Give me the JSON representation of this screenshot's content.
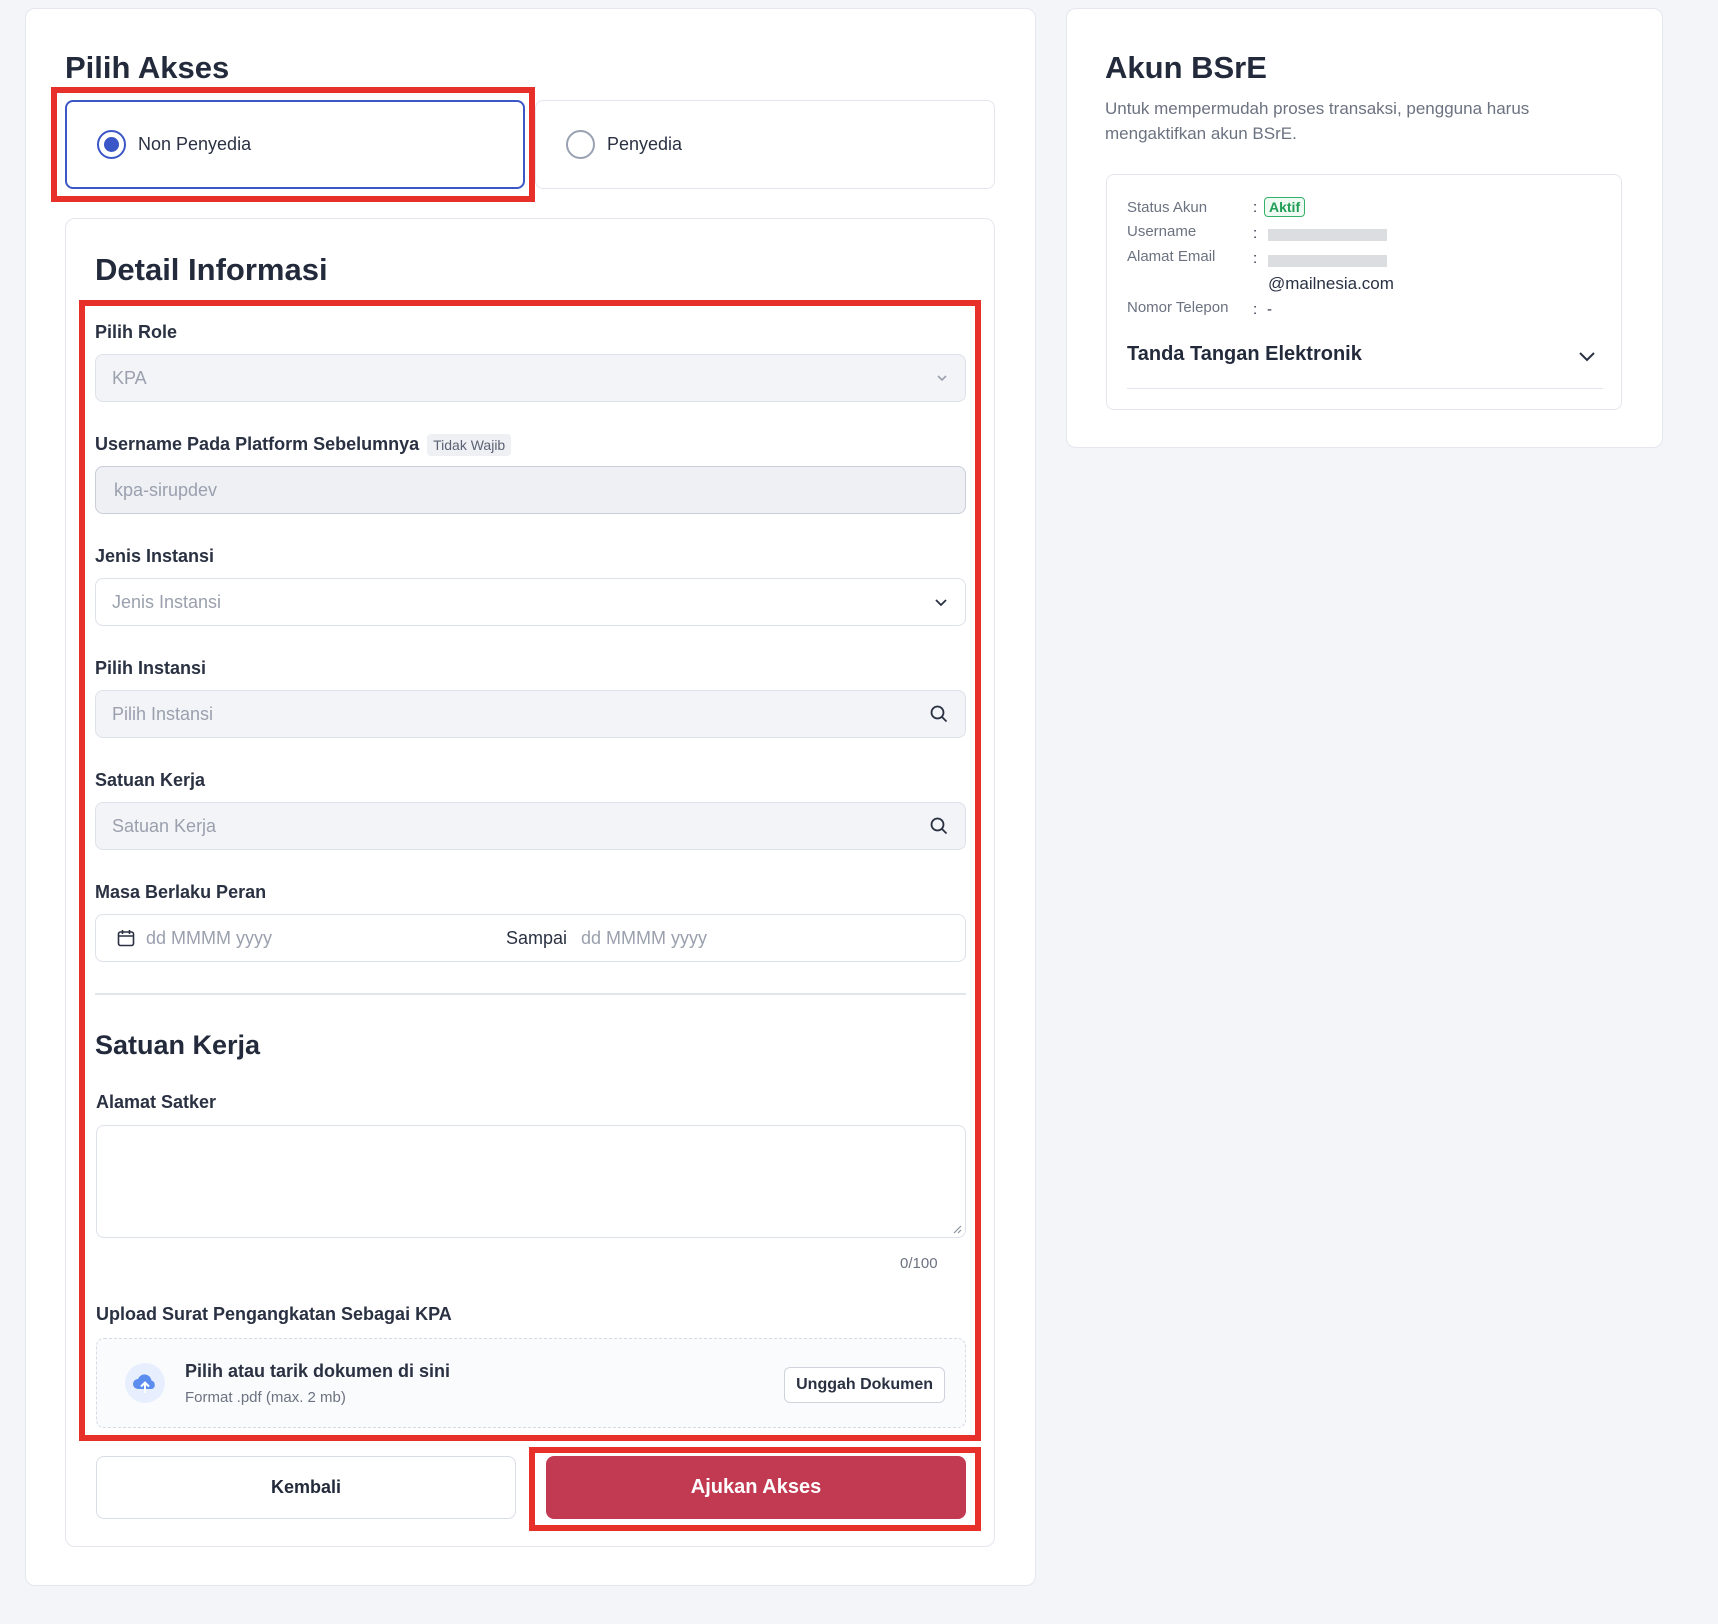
{
  "pilih_akses": {
    "title": "Pilih Akses",
    "options": [
      {
        "label": "Non Penyedia",
        "selected": true
      },
      {
        "label": "Penyedia",
        "selected": false
      }
    ]
  },
  "detail": {
    "title": "Detail Informasi",
    "role": {
      "label": "Pilih Role",
      "value": "KPA"
    },
    "username_prev": {
      "label": "Username Pada Platform Sebelumnya",
      "tag": "Tidak Wajib",
      "value": "kpa-sirupdev"
    },
    "jenis_instansi": {
      "label": "Jenis Instansi",
      "placeholder": "Jenis Instansi"
    },
    "pilih_instansi": {
      "label": "Pilih Instansi",
      "placeholder": "Pilih Instansi"
    },
    "satuan_kerja": {
      "label": "Satuan Kerja",
      "placeholder": "Satuan Kerja"
    },
    "masa_berlaku": {
      "label": "Masa Berlaku Peran",
      "start_placeholder": "dd MMMM yyyy",
      "separator": "Sampai",
      "end_placeholder": "dd MMMM yyyy"
    }
  },
  "satker": {
    "title": "Satuan Kerja",
    "alamat_label": "Alamat Satker",
    "alamat_value": "",
    "counter": "0/100",
    "upload_label": "Upload Surat Pengangkatan Sebagai KPA",
    "upload_title": "Pilih atau tarik dokumen di sini",
    "upload_hint": "Format .pdf (max. 2 mb)",
    "upload_button": "Unggah Dokumen"
  },
  "actions": {
    "back": "Kembali",
    "submit": "Ajukan Akses"
  },
  "bsre": {
    "title": "Akun BSrE",
    "description": "Untuk mempermudah proses transaksi, pengguna harus mengaktifkan akun BSrE.",
    "status_label": "Status Akun",
    "status_value": "Aktif",
    "username_label": "Username",
    "email_label": "Alamat Email",
    "email_domain": "@mailnesia.com",
    "phone_label": "Nomor Telepon",
    "phone_value": "-",
    "colon": ":",
    "ttd_label": "Tanda Tangan Elektronik"
  },
  "colors": {
    "accent": "#3b56c7",
    "submit": "#c23a52",
    "highlight": "#e8302b",
    "success": "#1f9d55"
  }
}
